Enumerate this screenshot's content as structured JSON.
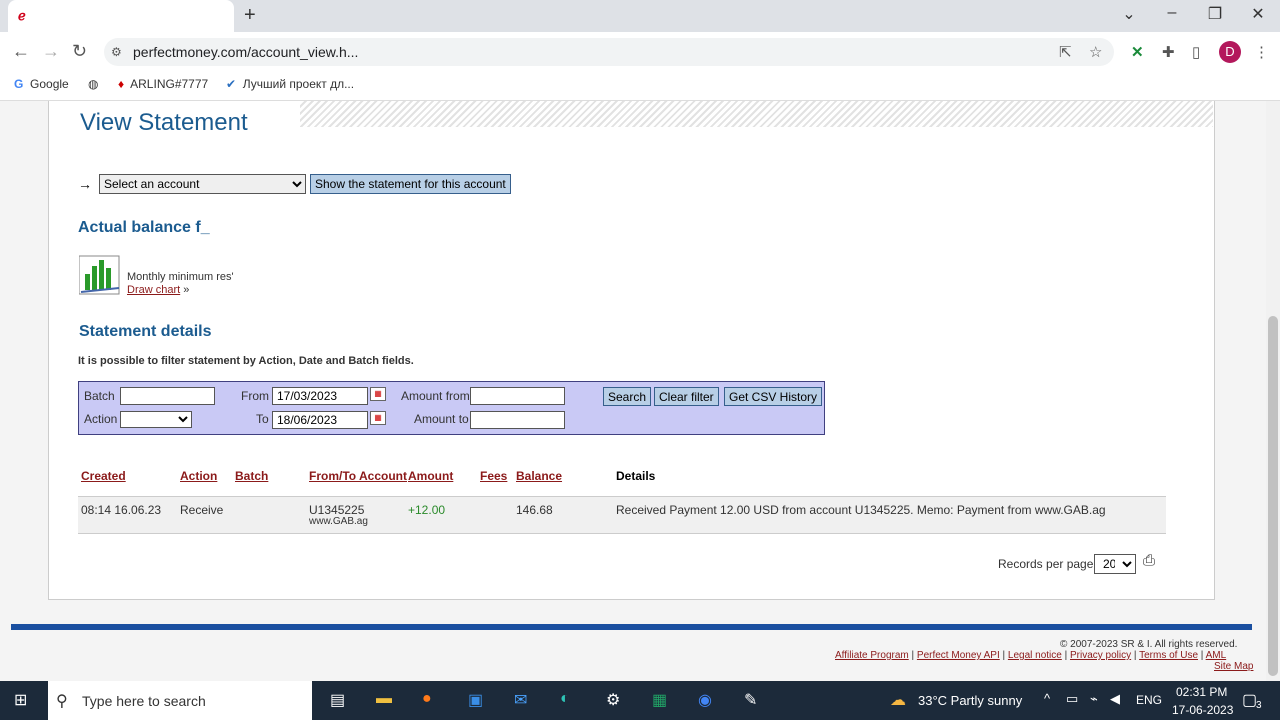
{
  "browser": {
    "tab_favicon": "ℯ",
    "new_tab": "+",
    "url": "perfectmoney.com/account_view.h...",
    "avatar": "D",
    "bookmarks": [
      "Google",
      "ARLING#7777",
      "Лучший проект дл..."
    ]
  },
  "page": {
    "title": "View Statement",
    "arrow": "→",
    "account_select": "Select an account",
    "show_button": "Show the statement for this account",
    "balance_heading": "Actual balance f_",
    "monthly_text": "Monthly minimum res'",
    "draw_chart": "Draw chart",
    "draw_chart_suffix": "»",
    "details_heading": "Statement details",
    "filter_hint": "It is possible to filter statement by Action, Date and Batch fields."
  },
  "filter": {
    "batch_label": "Batch",
    "action_label": "Action",
    "from_label": "From",
    "to_label": "To",
    "from_value": "17/03/2023",
    "to_value": "18/06/2023",
    "amount_from_label": "Amount from",
    "amount_to_label": "Amount to",
    "search": "Search",
    "clear": "Clear filter",
    "csv": "Get CSV History"
  },
  "table": {
    "headers": {
      "created": "Created",
      "action": "Action",
      "batch": "Batch",
      "account": "From/To Account",
      "amount": "Amount",
      "fees": "Fees",
      "balance": "Balance",
      "details": "Details"
    },
    "rows": [
      {
        "created": "08:14 16.06.23",
        "action": "Receive",
        "account": "U1345225",
        "account_sub": "www.GAB.ag",
        "amount": "+12.00",
        "balance": "146.68",
        "details": "Received Payment 12.00 USD from account U1345225. Memo: Payment from www.GAB.ag"
      }
    ]
  },
  "pagination": {
    "records_label": "Records per page:",
    "per_page": "20"
  },
  "footer": {
    "copyright": "© 2007-2023 SR & I. All rights reserved.",
    "links": [
      "Affiliate Program",
      "Perfect Money API",
      "Legal notice",
      "Privacy policy",
      "Terms of Use",
      "AML"
    ],
    "sitemap": "Site Map"
  },
  "taskbar": {
    "search_placeholder": "Type here to search",
    "weather": "33°C  Partly sunny",
    "lang": "ENG",
    "time": "02:31 PM",
    "date": "17-06-2023",
    "notifications": "3"
  },
  "colors": {
    "title_blue": "#1b5b8f",
    "link_red": "#8b1a1a",
    "filter_bg": "#c9c9f5",
    "amount_green": "#2a8a2a",
    "footer_bar": "#1a4fa0"
  }
}
